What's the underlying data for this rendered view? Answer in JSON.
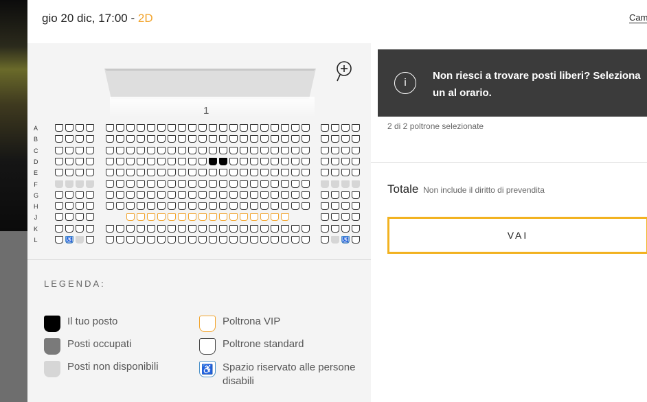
{
  "header": {
    "title_prefix": "gio 20 dic, 17:00 - ",
    "format": "2D",
    "change_link": "Cam"
  },
  "screen": {
    "number": "1",
    "zoom_icon": "zoom-in-icon"
  },
  "rows": [
    "A",
    "B",
    "C",
    "D",
    "E",
    "F",
    "G",
    "H",
    "J",
    "K",
    "L"
  ],
  "seat_states": {
    "D": {
      "sel": [
        14,
        15
      ]
    },
    "F": {
      "na": [
        0,
        1,
        2,
        3,
        24,
        25,
        26,
        27
      ]
    },
    "J": {
      "vip_only": true
    },
    "K": {},
    "L": {
      "dis": [
        1,
        26
      ],
      "na": [
        2,
        25
      ]
    }
  },
  "legend": {
    "title": "LEGENDA:",
    "items": [
      {
        "type": "sel",
        "label": "Il tuo posto"
      },
      {
        "type": "occ",
        "label": "Posti occupati"
      },
      {
        "type": "na",
        "label": "Posti non disponibili"
      },
      {
        "type": "vip",
        "label": "Poltrona VIP"
      },
      {
        "type": "std",
        "label": "Poltrone standard"
      },
      {
        "type": "dis",
        "label": "Spazio riservato alle persone disabili"
      }
    ]
  },
  "info": {
    "icon": "info-icon",
    "message": "Non riesci a trovare posti liberi? Seleziona un al orario."
  },
  "selection": {
    "count_text": "2 di 2 poltrone selezionate"
  },
  "total": {
    "label": "Totale",
    "note": "Non include il diritto di prevendita"
  },
  "go_button": "VAI",
  "colors": {
    "accent": "#f2a42c",
    "button_border": "#f2b220",
    "banner": "#3b3b3b",
    "disabled_blue": "#4a90c8"
  }
}
